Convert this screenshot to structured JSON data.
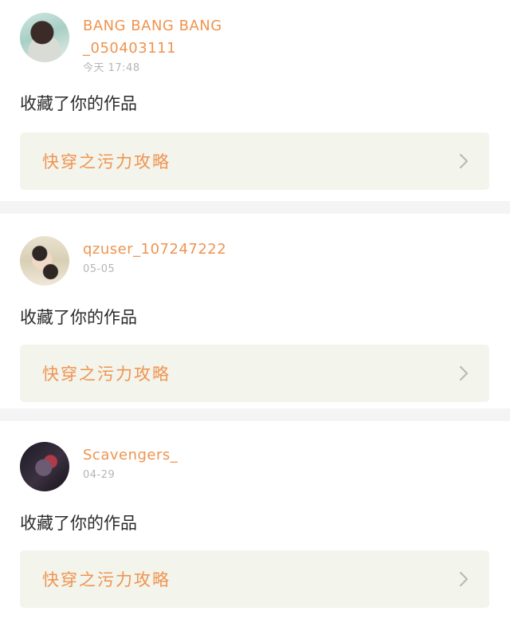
{
  "notifications": [
    {
      "username": "BANG BANG BANG_050403111",
      "time": "今天 17:48",
      "action": "收藏了你的作品",
      "work_title": "快穿之污力攻略"
    },
    {
      "username": "qzuser_107247222",
      "time": "05-05",
      "action": "收藏了你的作品",
      "work_title": "快穿之污力攻略"
    },
    {
      "username": "Scavengers_",
      "time": "04-29",
      "action": "收藏了你的作品",
      "work_title": "快穿之污力攻略"
    }
  ],
  "icons": {
    "chevron": "chevron-right-icon"
  },
  "colors": {
    "accent": "#ef9450",
    "card_bg": "#f3f4ec",
    "separator": "#f4f4f4",
    "time": "#b5b5b5"
  }
}
